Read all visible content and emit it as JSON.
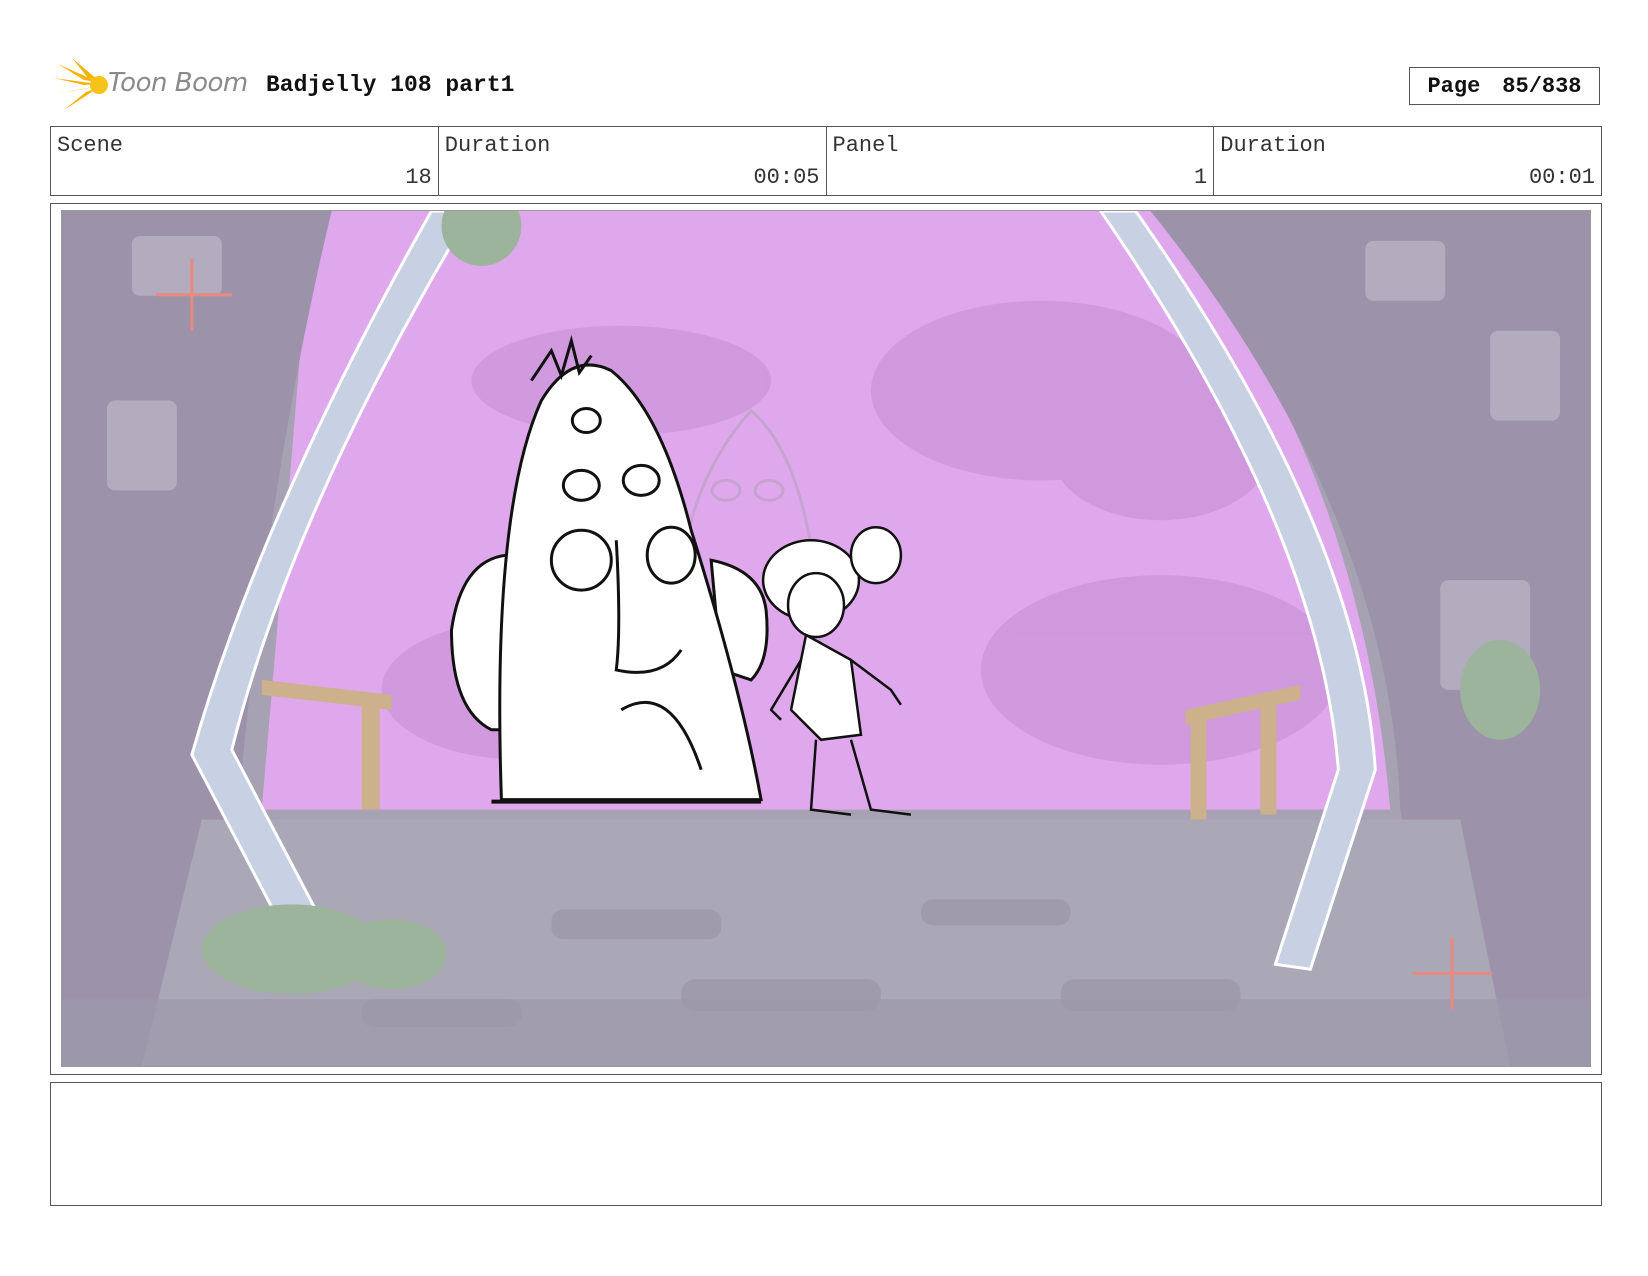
{
  "header": {
    "brand": "Toon Boom",
    "title": "Badjelly 108 part1",
    "page_label": "Page",
    "page_value": "85/838"
  },
  "info": [
    {
      "label": "Scene",
      "value": "18"
    },
    {
      "label": "Duration",
      "value": "00:05"
    },
    {
      "label": "Panel",
      "value": "1"
    },
    {
      "label": "Duration",
      "value": "00:01"
    }
  ],
  "panel": {
    "sky_color": "#e0a8ec",
    "background_color": "#a7a1b4",
    "ground_color": "#aaa7b7",
    "marker_color": "#e88a7e"
  },
  "notes": ""
}
